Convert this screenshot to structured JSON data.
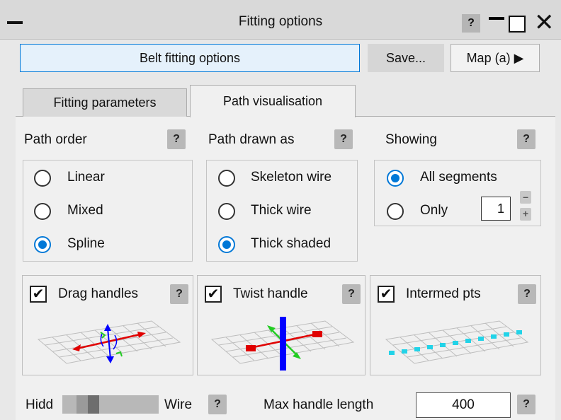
{
  "window": {
    "title": "Fitting options",
    "help_label": "?"
  },
  "toolbar": {
    "belt_label": "Belt fitting options",
    "save_label": "Save...",
    "map_label": "Map (a) ▶"
  },
  "tabs": [
    {
      "label": "Fitting parameters",
      "active": false
    },
    {
      "label": "Path visualisation",
      "active": true
    }
  ],
  "path_order": {
    "label": "Path order",
    "options": [
      "Linear",
      "Mixed",
      "Spline"
    ],
    "selected": "Spline"
  },
  "path_drawn_as": {
    "label": "Path drawn as",
    "options": [
      "Skeleton wire",
      "Thick wire",
      "Thick shaded"
    ],
    "selected": "Thick shaded"
  },
  "showing": {
    "label": "Showing",
    "options": [
      "All segments",
      "Only"
    ],
    "selected": "All segments",
    "only_value": "1",
    "minus": "–",
    "plus": "+"
  },
  "handles": {
    "drag": {
      "label": "Drag handles",
      "checked": true
    },
    "twist": {
      "label": "Twist handle",
      "checked": true
    },
    "intermed": {
      "label": "Intermed pts",
      "checked": true
    },
    "check_mark": "✔"
  },
  "footer": {
    "slider_left": "Hidd",
    "slider_right": "Wire",
    "max_handle_label": "Max handle length",
    "max_handle_value": "400"
  },
  "colors": {
    "accent": "#0078d7",
    "drag_arrow": "#e00000",
    "twist_handle": "#0000ff",
    "green_arrow": "#22cc22",
    "intermed_points": "#22d3e8"
  }
}
